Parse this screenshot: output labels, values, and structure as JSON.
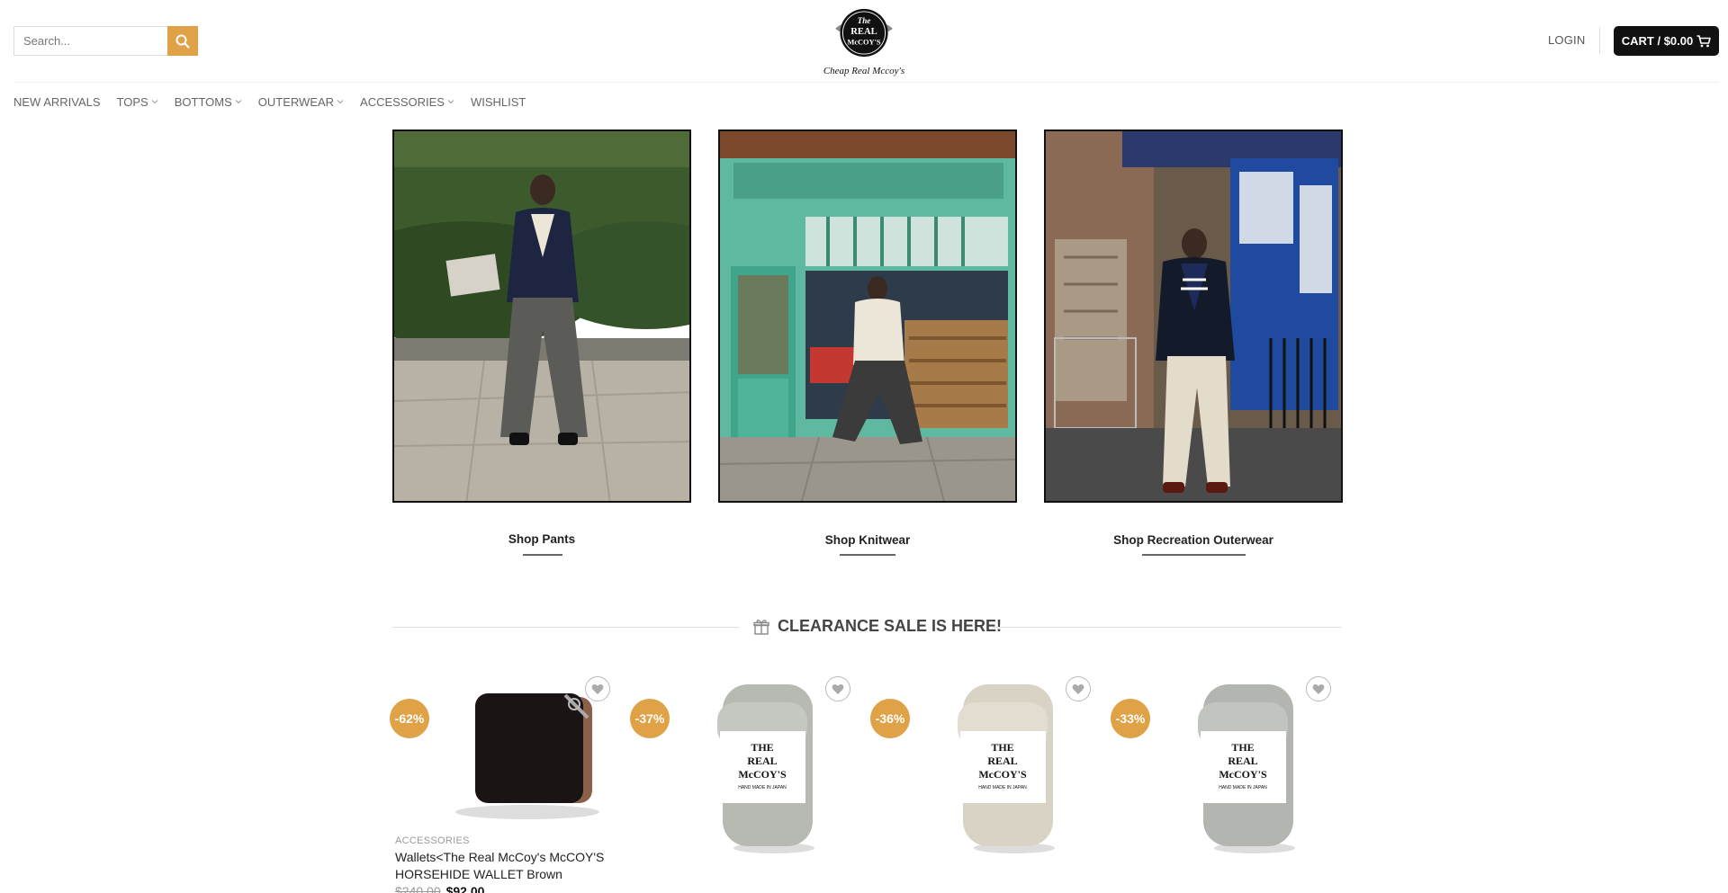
{
  "header": {
    "search_placeholder": "Search...",
    "logo_top": "The",
    "logo_mid": "REAL",
    "logo_bottom": "McCOY'S",
    "logo_tagline": "Cheap Real Mccoy's",
    "login_label": "LOGIN",
    "cart_label": "CART / $0.00",
    "accent_color": "#e0a247"
  },
  "nav": {
    "items": [
      {
        "label": "NEW ARRIVALS",
        "has_dropdown": false
      },
      {
        "label": "TOPS",
        "has_dropdown": true
      },
      {
        "label": "BOTTOMS",
        "has_dropdown": true
      },
      {
        "label": "OUTERWEAR",
        "has_dropdown": true
      },
      {
        "label": "ACCESSORIES",
        "has_dropdown": true
      },
      {
        "label": "WISHLIST",
        "has_dropdown": false
      }
    ]
  },
  "categories": [
    {
      "link_label": "Shop Pants"
    },
    {
      "link_label": "Shop Knitwear"
    },
    {
      "link_label": "Shop Recreation Outerwear"
    }
  ],
  "clearance": {
    "title": "CLEARANCE SALE IS HERE!",
    "icon": "gift-icon"
  },
  "products": [
    {
      "badge": "-62%",
      "image": "wallet",
      "category": "ACCESSORIES",
      "name": "Wallets<The Real McCoy's McCOY'S HORSEHIDE WALLET Brown",
      "old_price": "$240.00",
      "new_price": "$92.00"
    },
    {
      "badge": "-37%",
      "image": "socks-grey"
    },
    {
      "badge": "-36%",
      "image": "socks-oatmeal"
    },
    {
      "badge": "-33%",
      "image": "socks-grey"
    }
  ],
  "sock_label": {
    "line1": "THE",
    "line2": "REAL",
    "line3": "McCOY'S",
    "line4": "HAND MADE IN JAPAN"
  }
}
